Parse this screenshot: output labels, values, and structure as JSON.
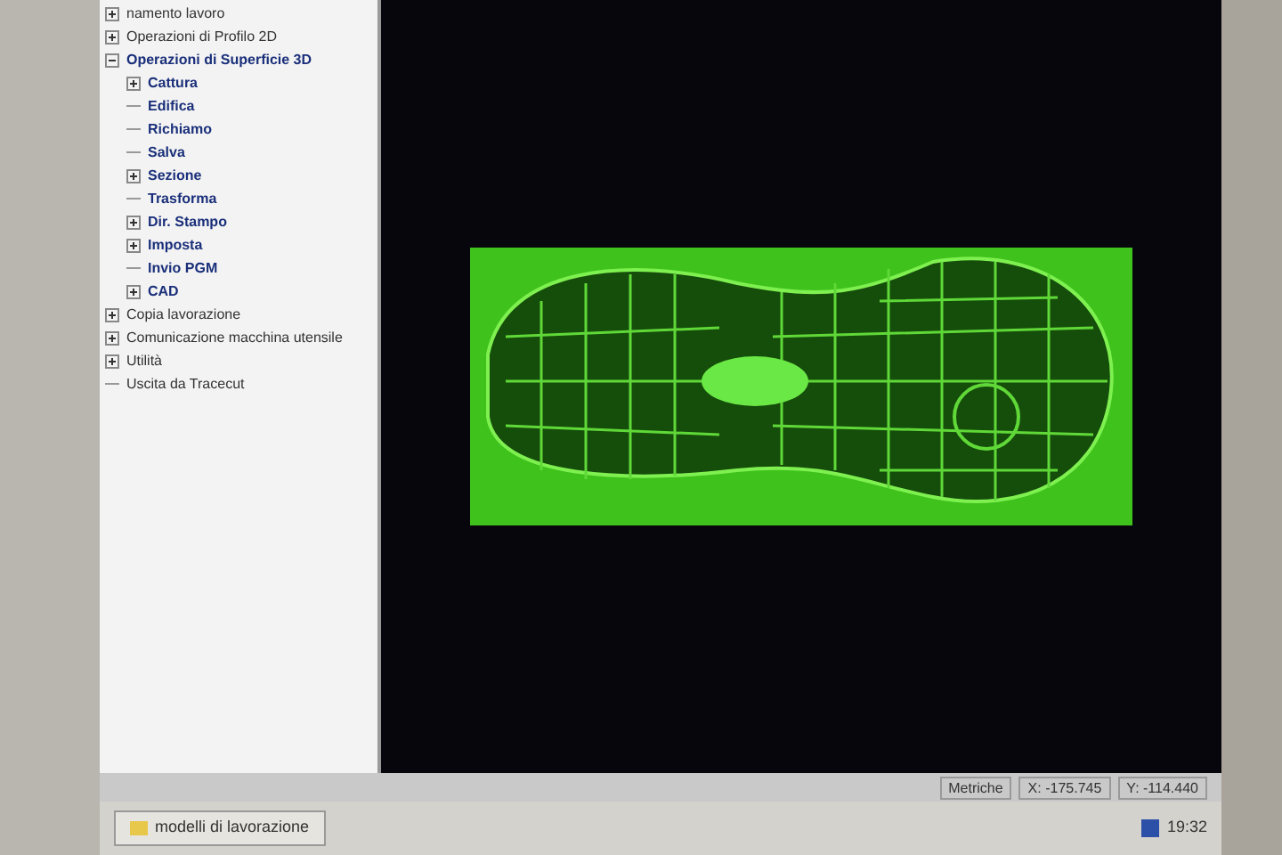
{
  "tree": [
    {
      "label": "namento lavoro",
      "expanded": false
    },
    {
      "label": "Operazioni di Profilo 2D",
      "expanded": false
    },
    {
      "label": "Operazioni di Superficie 3D",
      "expanded": true,
      "children": [
        {
          "label": "Cattura",
          "expanded": false
        },
        {
          "label": "Edifica"
        },
        {
          "label": "Richiamo"
        },
        {
          "label": "Salva"
        },
        {
          "label": "Sezione",
          "expanded": false
        },
        {
          "label": "Trasforma"
        },
        {
          "label": "Dir. Stampo",
          "expanded": false
        },
        {
          "label": "Imposta",
          "expanded": false
        },
        {
          "label": "Invio PGM"
        },
        {
          "label": "CAD",
          "expanded": false
        }
      ]
    },
    {
      "label": "Copia lavorazione",
      "expanded": false
    },
    {
      "label": "Comunicazione macchina utensile",
      "expanded": false
    },
    {
      "label": "Utilità",
      "expanded": false
    },
    {
      "label": "Uscita da Tracecut"
    }
  ],
  "status_bar": [
    "Metriche",
    "X: -175.745",
    "Y: -114.440"
  ],
  "taskbar": {
    "window_button": "modelli di lavorazione",
    "clock": "19:32"
  }
}
